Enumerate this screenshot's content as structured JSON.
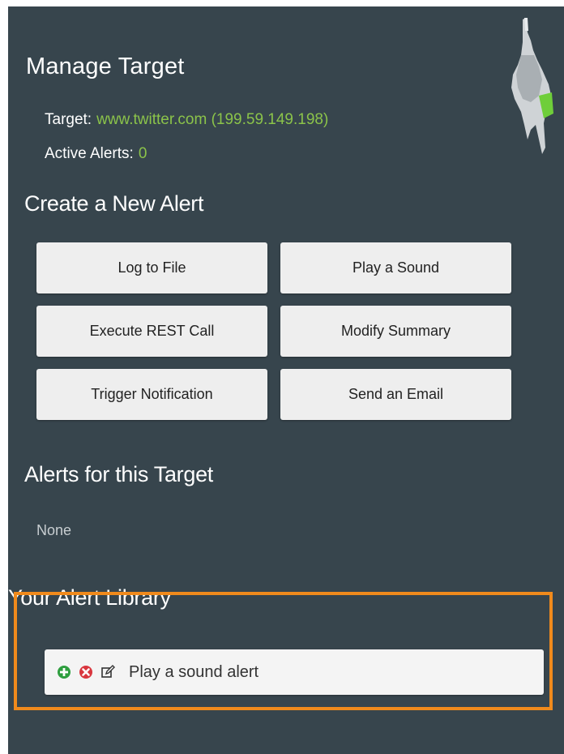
{
  "header": {
    "title": "Manage Target",
    "target_label": "Target:",
    "target_value": "www.twitter.com (199.59.149.198)",
    "active_alerts_label": "Active Alerts:",
    "active_alerts_value": "0"
  },
  "create_alert": {
    "heading": "Create a New Alert",
    "buttons": [
      {
        "label": "Log to File"
      },
      {
        "label": "Play a Sound"
      },
      {
        "label": "Execute REST Call"
      },
      {
        "label": "Modify Summary"
      },
      {
        "label": "Trigger Notification"
      },
      {
        "label": "Send an Email"
      }
    ]
  },
  "target_alerts": {
    "heading": "Alerts for this Target",
    "empty_text": "None"
  },
  "library": {
    "heading": "Your Alert Library",
    "items": [
      {
        "label": "Play a sound alert",
        "icons": [
          "add-icon",
          "remove-icon",
          "edit-icon"
        ]
      }
    ]
  },
  "colors": {
    "panel_bg": "#37454d",
    "accent_green": "#8bc34a",
    "highlight_orange": "#f08a1c",
    "button_bg": "#eeeeee",
    "add_green": "#2e9e3f",
    "remove_red": "#d9363e"
  }
}
